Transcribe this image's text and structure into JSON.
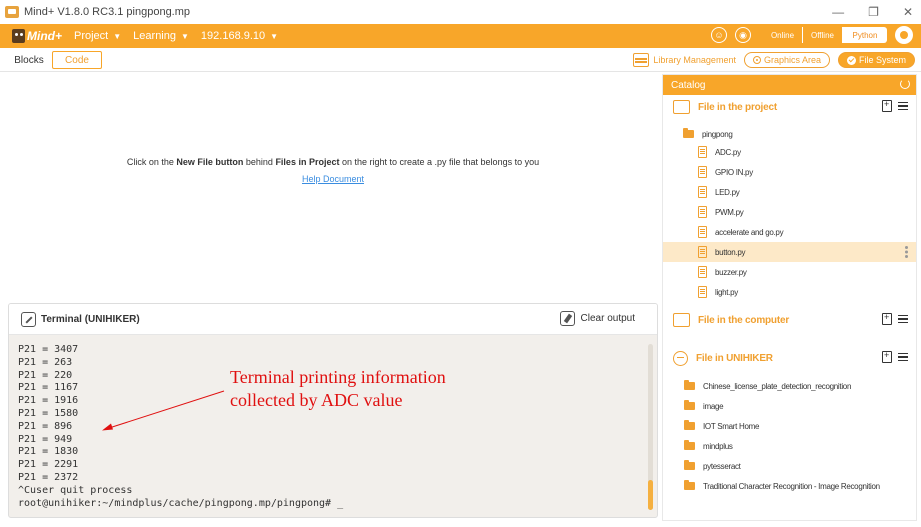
{
  "window": {
    "title": "Mind+ V1.8.0 RC3.1   pingpong.mp",
    "controls": [
      "—",
      "❐",
      "✕"
    ]
  },
  "menubar": {
    "logo": "Mind+",
    "items": [
      {
        "label": "Project"
      },
      {
        "label": "Learning"
      },
      {
        "label": "192.168.9.10"
      }
    ],
    "modes": [
      "Online",
      "Offline",
      "Python"
    ],
    "active_mode": "Python"
  },
  "tabs": {
    "blocks": "Blocks",
    "code": "Code",
    "library": "Library Management",
    "graphics": "Graphics Area",
    "filesystem": "File System"
  },
  "editor": {
    "hint_pre": "Click on the ",
    "hint_b1": "New File button",
    "hint_mid": " behind ",
    "hint_b2": "Files in Project",
    "hint_post": " on the right to create a .py file that belongs to you",
    "help_link": "Help Document"
  },
  "terminal": {
    "title": "Terminal (UNIHIKER)",
    "clear_label": "Clear output",
    "lines": [
      "P21 = 3407",
      "P21 = 263",
      "P21 = 220",
      "P21 = 1167",
      "P21 = 1916",
      "P21 = 1580",
      "P21 = 896",
      "P21 = 949",
      "P21 = 1830",
      "P21 = 2291",
      "P21 = 2372",
      "^Cuser quit process",
      "root@unihiker:~/mindplus/cache/pingpong.mp/pingpong# _"
    ]
  },
  "annotation": {
    "line1": "Terminal printing information",
    "line2": "collected by ADC value",
    "color": "#e01010"
  },
  "catalog": {
    "title": "Catalog",
    "project_section": "File in the project",
    "project_folder": "pingpong",
    "project_files": [
      "ADC.py",
      "GPIO IN.py",
      "LED.py",
      "PWM.py",
      "accelerate and go.py",
      "button.py",
      "buzzer.py",
      "light.py"
    ],
    "selected_file": "button.py",
    "computer_section": "File in the computer",
    "unihiker_section": "File in UNIHIKER",
    "unihiker_folders": [
      "Chinese_license_plate_detection_recognition",
      "image",
      "IOT Smart Home",
      "mindplus",
      "pytesseract",
      "Traditional Character Recognition - Image Recognition"
    ]
  },
  "colors": {
    "accent": "#f8a629",
    "selected_bg": "#fde9c8",
    "terminal_bg": "#f2efeb"
  }
}
